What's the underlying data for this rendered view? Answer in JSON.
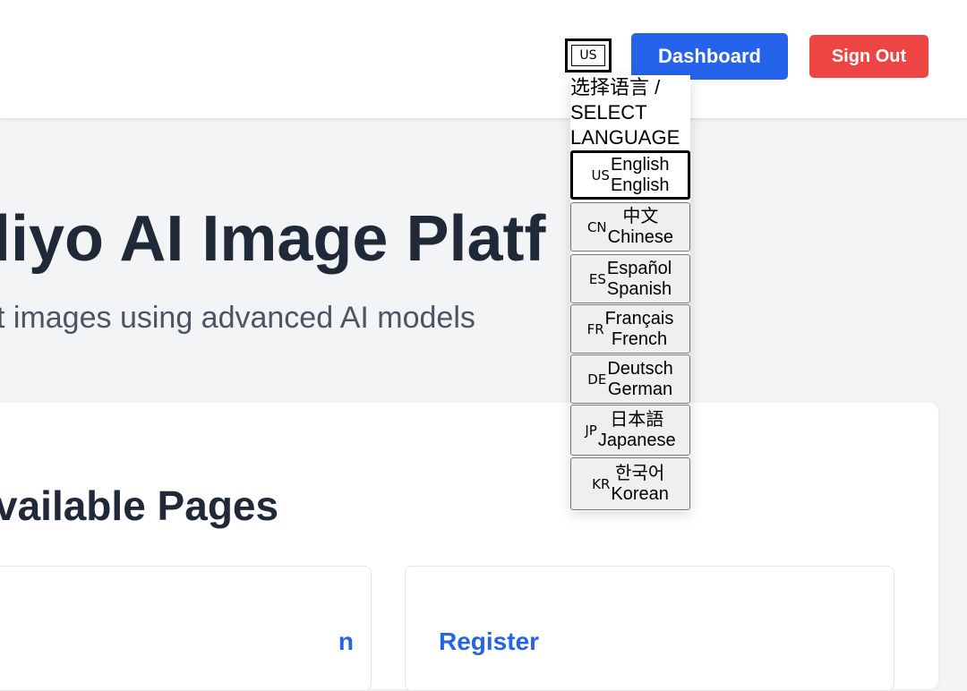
{
  "header": {
    "lang_toggle": "US",
    "dashboard_label": "Dashboard",
    "signout_label": "Sign Out"
  },
  "hero": {
    "title": "liyo AI Image Platf",
    "subtitle": "t images using advanced AI models"
  },
  "section": {
    "title": "vailable Pages",
    "cards": [
      {
        "title": "n"
      },
      {
        "title": "Register"
      }
    ]
  },
  "language_menu": {
    "heading": "选择语言 / SELECT LANGUAGE",
    "options": [
      {
        "code": "US",
        "native": "English",
        "english": "English",
        "selected": true
      },
      {
        "code": "CN",
        "native": "中文",
        "english": "Chinese"
      },
      {
        "code": "ES",
        "native": "Español",
        "english": "Spanish"
      },
      {
        "code": "FR",
        "native": "Français",
        "english": "French"
      },
      {
        "code": "DE",
        "native": "Deutsch",
        "english": "German"
      },
      {
        "code": "JP",
        "native": "日本語",
        "english": "Japanese"
      },
      {
        "code": "KR",
        "native": "한국어",
        "english": "Korean"
      }
    ]
  },
  "colors": {
    "primary": "#2563eb",
    "danger": "#ef4444",
    "background": "#f3f4f6",
    "text_dark": "#1f2937",
    "text_muted": "#4b5563"
  }
}
